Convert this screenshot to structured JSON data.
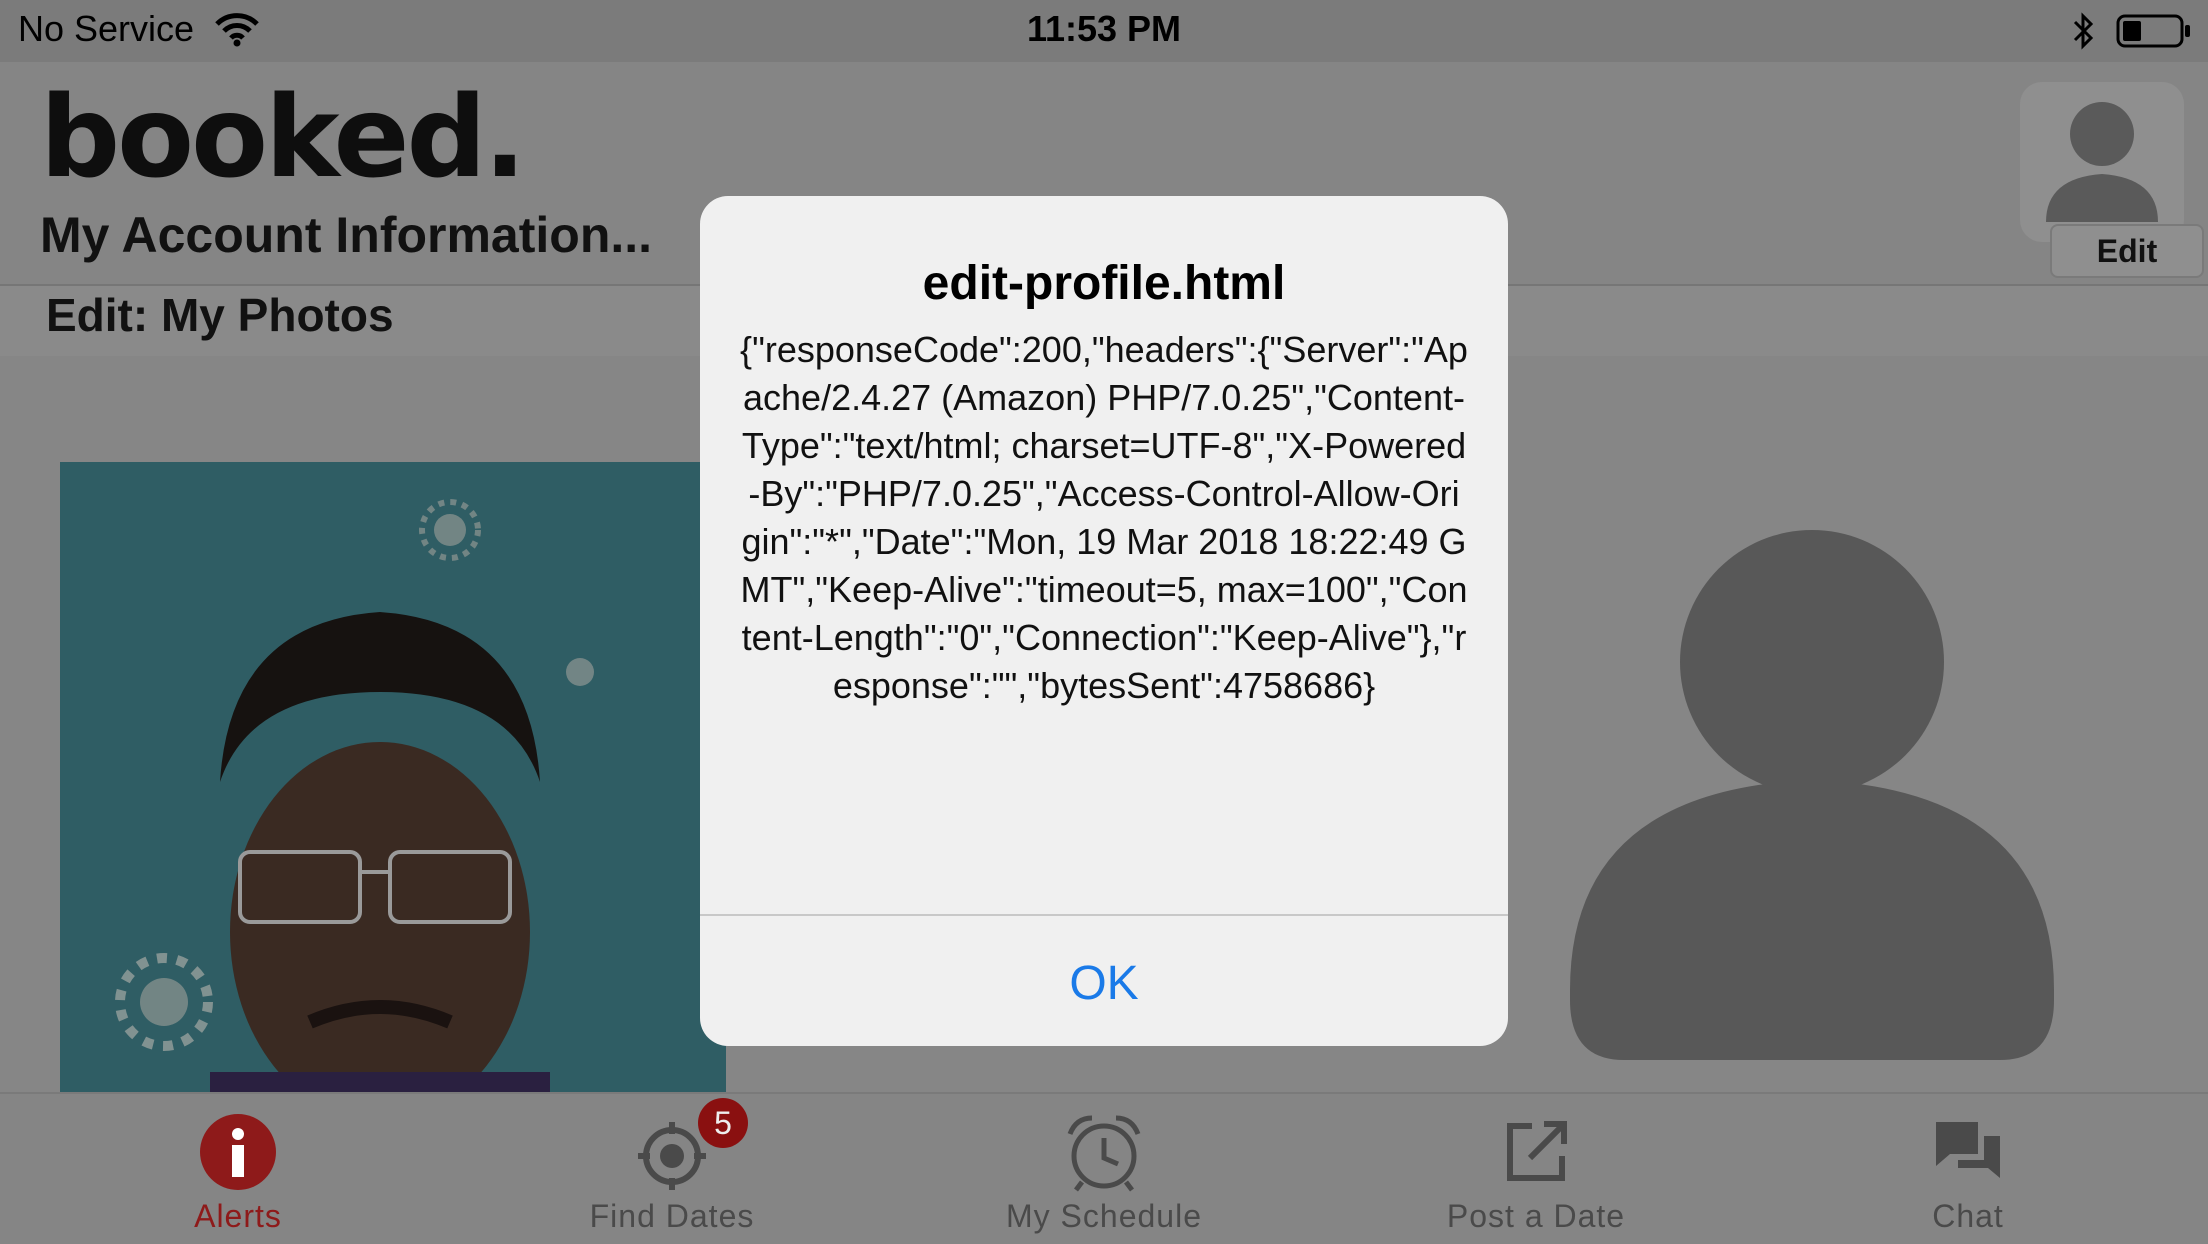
{
  "status_bar": {
    "carrier": "No Service",
    "time": "11:53 PM",
    "wifi_icon": "wifi-icon",
    "bluetooth_icon": "bluetooth-icon",
    "battery_icon": "battery-icon"
  },
  "header": {
    "logo": "booked.",
    "title": "My Account Information...",
    "avatar_edit_label": "Edit"
  },
  "section": {
    "title": "Edit: My Photos"
  },
  "alert": {
    "title": "edit-profile.html",
    "message": "{\"responseCode\":200,\"headers\":{\"Server\":\"Apache/2.4.27 (Amazon) PHP/7.0.25\",\"Content-Type\":\"text/html; charset=UTF-8\",\"X-Powered-By\":\"PHP/7.0.25\",\"Access-Control-Allow-Origin\":\"*\",\"Date\":\"Mon, 19 Mar 2018 18:22:49 GMT\",\"Keep-Alive\":\"timeout=5, max=100\",\"Content-Length\":\"0\",\"Connection\":\"Keep-Alive\"},\"response\":\"\",\"bytesSent\":4758686}",
    "ok_label": "OK"
  },
  "tabs": [
    {
      "label": "Alerts",
      "icon": "info-icon",
      "active": true
    },
    {
      "label": "Find Dates",
      "icon": "target-icon",
      "badge": "5"
    },
    {
      "label": "My Schedule",
      "icon": "alarm-clock-icon"
    },
    {
      "label": "Post a Date",
      "icon": "compose-icon"
    },
    {
      "label": "Chat",
      "icon": "chat-bubbles-icon"
    }
  ],
  "colors": {
    "accent": "#8e1a1a",
    "link": "#1a7ae8",
    "dim_overlay": "#8a8a8a"
  }
}
